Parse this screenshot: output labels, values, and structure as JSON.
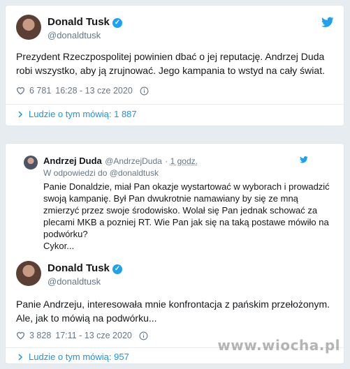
{
  "tweet1": {
    "name": "Donald Tusk",
    "handle": "@donaldtusk",
    "text": "Prezydent Rzeczpospolitej powinien dbać o jej reputację. Andrzej Duda robi wszystko, aby ją zrujnować. Jego kampania to wstyd na cały świat.",
    "likes": "6 781",
    "time": "16:28 - 13 cze 2020",
    "people_label": "Ludzie o tym mówią: 1 887"
  },
  "quoted": {
    "name": "Andrzej Duda",
    "handle": "@AndrzejDuda",
    "time": "1 godz.",
    "reply_to": "W odpowiedzi do @donaldtusk",
    "lines": [
      "Panie Donaldzie, miał Pan okazje wystartować w wyborach i prowadzić",
      "swoją kampanię. Był Pan dwukrotnie namawiany by się ze mną",
      "zmierzyć przez swoje środowisko. Wolał się Pan jednak schować za",
      "plecami MKB a pozniej RT. Wie Pan jak się na taką postawe mówiło na",
      "podwórku?",
      "Cykor..."
    ]
  },
  "tweet2": {
    "name": "Donald Tusk",
    "handle": "@donaldtusk",
    "text": "Panie Andrzeju, interesowała mnie konfrontacja z pańskim przełożonym. Ale, jak to mówią na podwórku...",
    "likes": "3 828",
    "time": "17:11 - 13 cze 2020",
    "people_label": "Ludzie o tym mówią: 957"
  },
  "icons": {
    "heart": "heart-icon",
    "info": "info-icon",
    "twitter": "twitter-bird-icon",
    "verified": "verified-badge-icon",
    "chevron": "chevron-right-icon"
  },
  "colors": {
    "accent": "#1da1f2",
    "link": "#1b95e0",
    "muted": "#657786"
  },
  "watermark": "www.wiocha.pl"
}
